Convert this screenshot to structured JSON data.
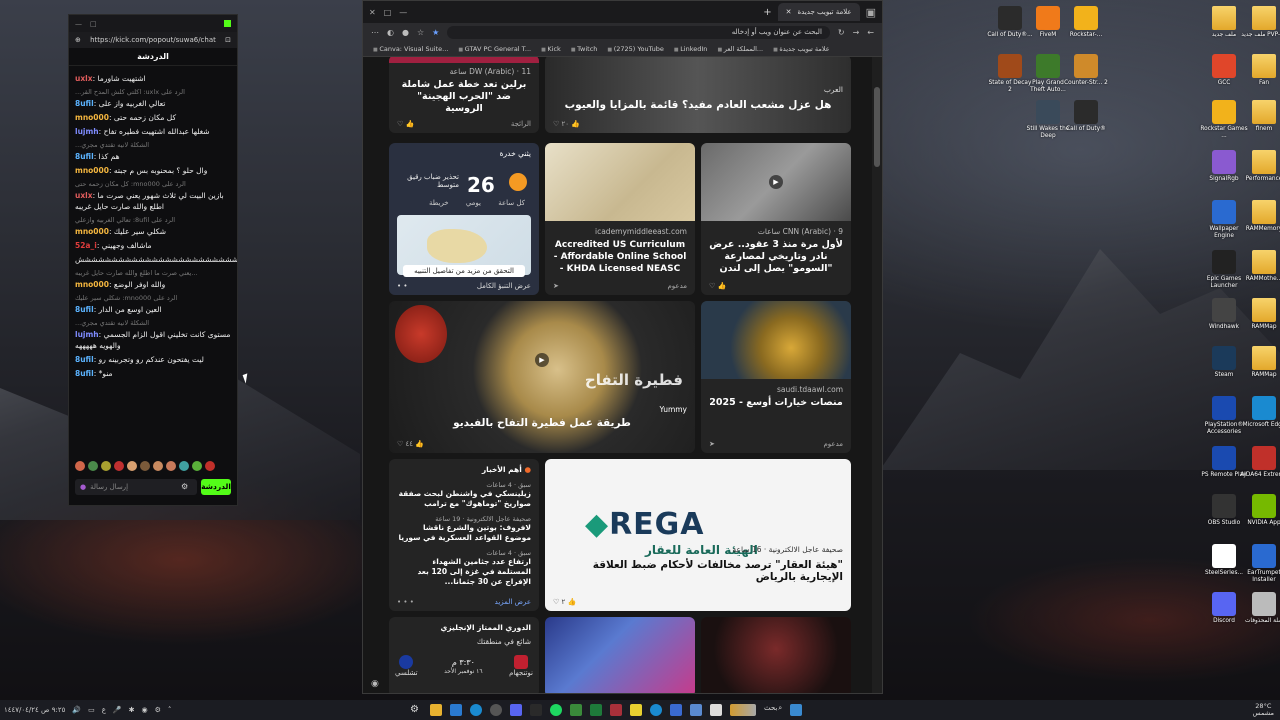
{
  "chat": {
    "url": "https://kick.com/popout/suwa6/chat",
    "header": "الدردشة",
    "messages": [
      {
        "user": "uxlx",
        "color": "#e05c5c",
        "text": "اشتهيت شاورما"
      },
      {
        "reply": "الرد على uxlx: اكلتي كلش المدح القر...",
        "user": "8ufil",
        "color": "#5bb3ff",
        "text": "تعالي الغربيه واز على"
      },
      {
        "user": "mno000",
        "color": "#f4b63f",
        "text": "كل مكان زحمه حتى"
      },
      {
        "user": "lujmh",
        "color": "#7f8cff",
        "text": "شغلها عبدالله اشتهيت فطيره تفاح"
      },
      {
        "reply": "الشكلة لانيه تقتدي مجري...",
        "user": "8ufil",
        "color": "#5bb3ff",
        "text": "هم كذا"
      },
      {
        "user": "mno000",
        "color": "#f4b63f",
        "text": "وال حلو ؟ بمحنوبه بس م جبته"
      },
      {
        "reply": "الرد على mno000: كل مكان زحمه حتى",
        "user": "uxlx",
        "color": "#e05c5c",
        "text": "بازين البيت لي ثلاث شهور يعني صرت ما اطلع والله صارت حايل غريبه"
      },
      {
        "reply": "الرد على 8ufil: تعالي الغربيه وازعلي",
        "user": "mno000",
        "color": "#f4b63f",
        "text": "شكلي سير عليك"
      },
      {
        "user": "52a_i",
        "color": "#e03c3c",
        "text": "ماشالف وجهيني"
      },
      {
        "user": "",
        "color": "#ffffff",
        "text": "شششششششششششششششششششششششششششش"
      },
      {
        "reply": "...يعني صرت ما اطلع والله صارت حايل غريبه",
        "user": "mno000",
        "color": "#f4b63f",
        "text": "والله اوفر الوضع"
      },
      {
        "reply": "الرد على mno000: شكلي سير عليك",
        "user": "8ufil",
        "color": "#5bb3ff",
        "text": "العين اوسع من الدار"
      },
      {
        "reply": "الشكلة لانيه تقتدي مجري...",
        "user": "lujmh",
        "color": "#7f8cff",
        "text": "مستوى كانت تخليني اقول الزام الجسمي والهويه هههههه"
      },
      {
        "user": "8ufil",
        "color": "#5bb3ff",
        "text": "ليت يفتحون عندكم رو وتجربينه رو"
      },
      {
        "user": "8ufil",
        "color": "#5bb3ff",
        "text": "*منو"
      }
    ],
    "input_placeholder": "إرسال رسالة",
    "send_label": "الدردشة"
  },
  "browser": {
    "tab_title": "علامة تبويب جديدة",
    "address": "البحث عن عنوان ويب أو إدخاله",
    "bookmarks": [
      "Canva: Visual Suite...",
      "GTAV PC General T...",
      "Kick",
      "Twitch",
      "(2725) YouTube",
      "LinkedIn",
      "المملكة العر...",
      "علامة تبويب جديدة"
    ]
  },
  "feed": {
    "card1": {
      "source": "DW (Arabic) · 11 ساعة",
      "title": "برلين تعد خطة عمل شاملة ضد \"الحرب الهجينة\" الروسية",
      "foot": "الرائجة"
    },
    "card2": {
      "source": "العرب",
      "title": "هل عزل مشعب العادم مفيد؟ قائمة بالمزايا والعيوب",
      "likes": "٢٠"
    },
    "weather": {
      "label": "يثني خدرة",
      "temp": "26",
      "unit": "°C",
      "warning": "تحذير ضباب رقيق متوسط",
      "tabs": [
        "كل ساعة",
        "يومي",
        "خريطة"
      ],
      "note": "التحقق من مزيد من تفاصيل التنبيه",
      "footer": "عرض التنبؤ الكامل"
    },
    "card3": {
      "source": "icademymiddleeast.com",
      "title": "Accredited US Curriculum - Affordable Online School - KHDA Licensed NEASC",
      "foot": "مدعوم"
    },
    "card4": {
      "source": "CNN (Arabic) · 9 ساعات",
      "title": "لأول مرة منذ 3 عقود.. عرض نادر وتاريخي لمصارعة \"السومو\" يصل إلى لندن"
    },
    "card5": {
      "source": "Yummy",
      "title": "طريقة عمل فطيرة التفاح بالفيديو",
      "overlay": "فطيرة التفاح",
      "likes": "٤٤"
    },
    "card6": {
      "source": "saudi.tdaawl.com",
      "title": "منصات خيارات أوسع - 2025",
      "foot": "مدعوم"
    },
    "top_news": {
      "heading": "أهم الأخبار",
      "items": [
        {
          "meta": "سبق · 4 ساعات",
          "h": "زيلينسكي في واشنطن لبحث صفقة صواريخ \"توماهوك\" مع ترامب"
        },
        {
          "meta": "صحيفة عاجل الالكترونية · 19 ساعة",
          "h": "لافروف: بوتين والشرع ناقشا موضوع القواعد العسكرية في سوريا"
        },
        {
          "meta": "سبق · 4 ساعات",
          "h": "ارتفاع عدد جثامين الشهداء المستلمة في غزة إلى 120 بعد الإفراج عن 30 جثمانا..."
        }
      ],
      "more": "عرض المزيد"
    },
    "rega": {
      "logo": "REGA",
      "logo_ar": "الهيئة العامة للعقار",
      "source": "صحيفة عاجل الالكترونية · 16 ساعة",
      "title": "\"هيئة العقار\" ترصد مخالفات لأحكام ضبط العلاقة الإيجارية بالرياض",
      "likes": "٢"
    },
    "sports": {
      "league": "الدوري الممتاز الإنجليزي",
      "sub": "شائع في منطقتك",
      "time": "٣:٣٠ م",
      "date": "١٦ نوفمبر الأحد",
      "home": "نوتنجهام",
      "away": "تشلسي"
    }
  },
  "desktop_icons": [
    {
      "label": "Call of Duty®...",
      "color": "#2b2b2b"
    },
    {
      "label": "FiveM",
      "color": "#f07a1a"
    },
    {
      "label": "Rockstar-...",
      "color": "#f2b21b"
    },
    {
      "label": "ملف جديد",
      "color": "folder"
    },
    {
      "label": "ملف جديد PVP-Pc",
      "color": "folder"
    },
    {
      "label": "State of Decay 2",
      "color": "#a04a1a"
    },
    {
      "label": "Play Grand Theft Auto...",
      "color": "#3d7a2a"
    },
    {
      "label": "Counter-Str... 2",
      "color": "#cf8a2a"
    },
    {
      "label": "GCC",
      "color": "#e0462a"
    },
    {
      "label": "Fan",
      "color": "folder"
    },
    {
      "label": "Still Wakes the Deep",
      "color": "#3a4a5a"
    },
    {
      "label": "Call of Duty®",
      "color": "#2b2b2b"
    },
    {
      "label": "Rockstar Games ...",
      "color": "#f2b21b"
    },
    {
      "label": "finem",
      "color": "folder"
    },
    {
      "label": "SignalRgb",
      "color": "#8a5ad0"
    },
    {
      "label": "Performance",
      "color": "folder"
    },
    {
      "label": "Wallpaper Engine",
      "color": "#2a6ad0"
    },
    {
      "label": "RAMMemory",
      "color": "folder"
    },
    {
      "label": "Epic Games Launcher",
      "color": "#222"
    },
    {
      "label": "RAMMothe...",
      "color": "folder"
    },
    {
      "label": "Windhawk",
      "color": "#444"
    },
    {
      "label": "RAMMap",
      "color": "folder"
    },
    {
      "label": "Steam",
      "color": "#1b3a5a"
    },
    {
      "label": "RAMMap",
      "color": "folder"
    },
    {
      "label": "PlayStation® Accessories",
      "color": "#1a4ab0"
    },
    {
      "label": "Microsoft Edge",
      "color": "#1a8ad0"
    },
    {
      "label": "PS Remote Play",
      "color": "#1a4ab0"
    },
    {
      "label": "AIDA64 Extreme",
      "color": "#c0302a"
    },
    {
      "label": "OBS Studio",
      "color": "#333"
    },
    {
      "label": "NVIDIA App",
      "color": "#76b900"
    },
    {
      "label": "SteelSeries...",
      "color": "#fff"
    },
    {
      "label": "EarTrumpet Installer",
      "color": "#2a6ad0"
    },
    {
      "label": "Discord",
      "color": "#5865f2"
    },
    {
      "label": "سلة المحذوفات",
      "color": "#bbb"
    }
  ],
  "taskbar": {
    "search": "بحث",
    "clock": "٩:٢٥ ص",
    "date": "١٤٤٧/٠٤/٢٤",
    "weather_temp": "28°C",
    "weather_desc": "مشمس",
    "lang": "ع"
  }
}
